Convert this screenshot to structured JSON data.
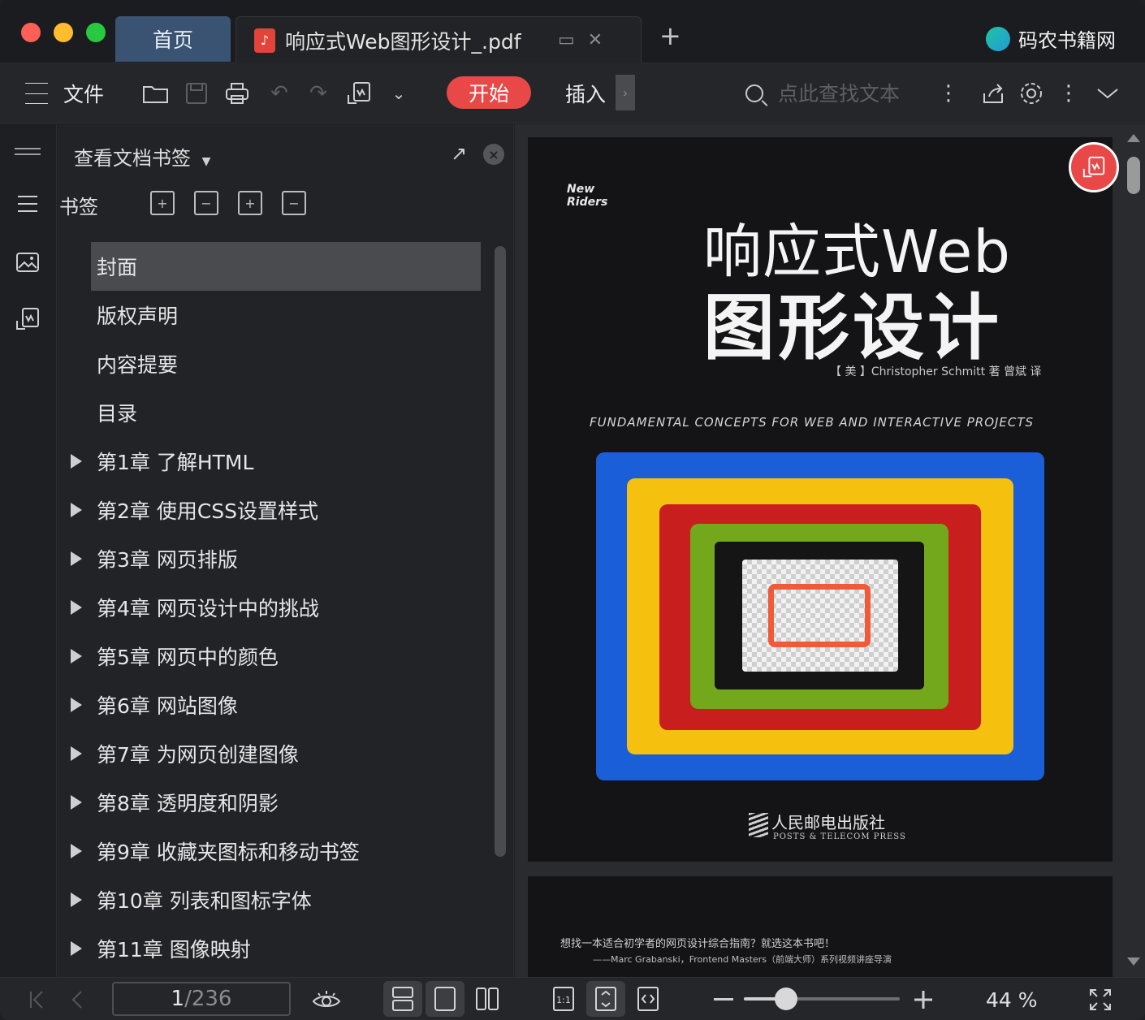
{
  "titlebar": {
    "home_tab": "首页",
    "doc_tab": "响应式Web图形设计_.pdf",
    "brand": "码农书籍网",
    "brand_logo_text": "书籍网"
  },
  "toolbar": {
    "file_label": "文件",
    "start_label": "开始",
    "insert_label": "插入",
    "search_placeholder": "点此查找文本"
  },
  "bookmark_panel": {
    "title": "查看文档书签",
    "bookmarks_label": "书签",
    "items": [
      {
        "label": "封面",
        "expandable": false,
        "active": true
      },
      {
        "label": "版权声明",
        "expandable": false,
        "active": false
      },
      {
        "label": "内容提要",
        "expandable": false,
        "active": false
      },
      {
        "label": "目录",
        "expandable": false,
        "active": false
      },
      {
        "label": "第1章 了解HTML",
        "expandable": true,
        "active": false
      },
      {
        "label": "第2章 使用CSS设置样式",
        "expandable": true,
        "active": false
      },
      {
        "label": "第3章 网页排版",
        "expandable": true,
        "active": false
      },
      {
        "label": "第4章 网页设计中的挑战",
        "expandable": true,
        "active": false
      },
      {
        "label": "第5章 网页中的颜色",
        "expandable": true,
        "active": false
      },
      {
        "label": "第6章 网站图像",
        "expandable": true,
        "active": false
      },
      {
        "label": "第7章 为网页创建图像",
        "expandable": true,
        "active": false
      },
      {
        "label": "第8章 透明度和阴影",
        "expandable": true,
        "active": false
      },
      {
        "label": "第9章 收藏夹图标和移动书签",
        "expandable": true,
        "active": false
      },
      {
        "label": "第10章 列表和图标字体",
        "expandable": true,
        "active": false
      },
      {
        "label": "第11章 图像映射",
        "expandable": true,
        "active": false
      }
    ]
  },
  "cover": {
    "imprint_line1": "New",
    "imprint_line2": "Riders",
    "title_line1": "响应式Web",
    "title_line2": "图形设计",
    "author": "【 美 】Christopher Schmitt  著    曾斌  译",
    "tagline": "FUNDAMENTAL CONCEPTS FOR WEB AND INTERACTIVE PROJECTS",
    "publisher": "人民邮电出版社",
    "publisher_en": "POSTS & TELECOM PRESS"
  },
  "page2": {
    "quote": "想找一本适合初学者的网页设计综合指南？就选这本书吧！",
    "cite": "——Marc Grabanski，Frontend Masters（前端大师）系列视频讲座导演"
  },
  "statusbar": {
    "current_page": "1",
    "total_pages": "/236",
    "zoom": "44 %",
    "zoom_level": 0.27
  },
  "colors": {
    "accent": "#e84848",
    "home_tab": "#3b5372"
  }
}
